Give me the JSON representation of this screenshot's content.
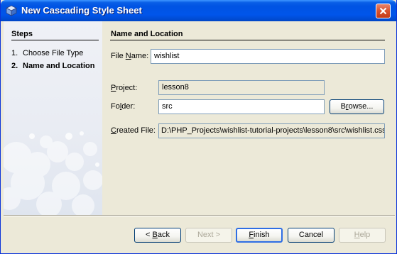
{
  "window": {
    "title": "New Cascading Style Sheet",
    "icon": "cube-icon",
    "close_icon": "close-icon",
    "accent": "#0054e3"
  },
  "steps": {
    "heading": "Steps",
    "items": [
      {
        "number": "1.",
        "label": "Choose File Type",
        "current": false
      },
      {
        "number": "2.",
        "label": "Name and Location",
        "current": true
      }
    ]
  },
  "content": {
    "heading": "Name and Location",
    "file_name": {
      "label_prefix": "File ",
      "label_mnemonic": "N",
      "label_suffix": "ame:",
      "value": "wishlist"
    },
    "project": {
      "label_prefix": "",
      "label_mnemonic": "P",
      "label_suffix": "roject:",
      "value": "lesson8"
    },
    "folder": {
      "label_prefix": "Fo",
      "label_mnemonic": "l",
      "label_suffix": "der:",
      "value": "src",
      "browse_label_prefix": "B",
      "browse_label_mnemonic": "r",
      "browse_label_suffix": "owse..."
    },
    "created_file": {
      "label_prefix": "",
      "label_mnemonic": "C",
      "label_suffix": "reated File:",
      "value": "D:\\PHP_Projects\\wishlist-tutorial-projects\\lesson8\\src\\wishlist.css"
    }
  },
  "buttons": {
    "back": {
      "prefix": "< ",
      "mnemonic": "B",
      "suffix": "ack"
    },
    "next": {
      "label": "Next >"
    },
    "finish": {
      "prefix": "",
      "mnemonic": "F",
      "suffix": "inish"
    },
    "cancel": {
      "label": "Cancel"
    },
    "help": {
      "prefix": "",
      "mnemonic": "H",
      "suffix": "elp"
    }
  }
}
